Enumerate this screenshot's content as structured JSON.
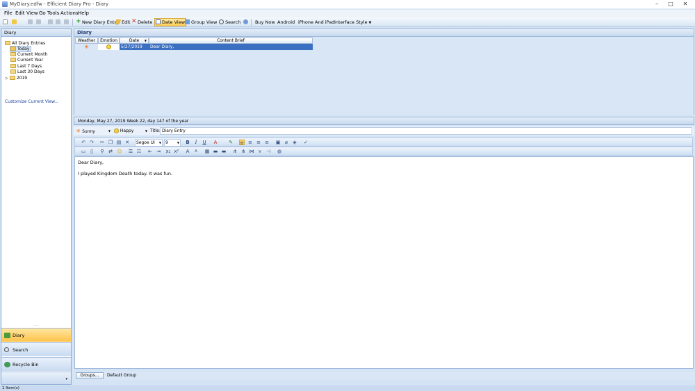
{
  "window": {
    "title": "MyDiary.edfw - Efficient Diary Pro - Diary",
    "minimize": "–",
    "maximize": "□",
    "close": "✕"
  },
  "menu": [
    "File",
    "Edit",
    "View",
    "Go",
    "Tools",
    "Actions",
    "Help"
  ],
  "toolbar": {
    "new_entry": "New Diary Entry",
    "edit": "Edit",
    "delete": "Delete",
    "date_view": "Date View",
    "group_view": "Group View",
    "search": "Search",
    "buy_now": "Buy Now",
    "android": "Android",
    "iphone_ipad": "iPhone And iPad",
    "interface_style": "Interface Style"
  },
  "sidebar": {
    "header": "Diary",
    "tree": {
      "root": "All Diary Entries",
      "items": [
        "Today",
        "Current Month",
        "Current Year",
        "Last 7 Days",
        "Last 30 Days"
      ],
      "year": "2019"
    },
    "customize_link": "Customize Current View...",
    "nav": {
      "diary": "Diary",
      "search": "Search",
      "recycle_bin": "Recycle Bin"
    }
  },
  "main": {
    "header": "Diary",
    "columns": [
      "Weather",
      "Emotion",
      "Date",
      "Content Brief"
    ],
    "rows": [
      {
        "date": "5/27/2019",
        "brief": "Dear Diary,"
      }
    ]
  },
  "entry": {
    "date_line": "Monday, May 27, 2019   Week 22, day 147 of the year",
    "weather": "Sunny",
    "emotion": "Happy",
    "title_label": "Title:",
    "title_value": "Diary Entry",
    "font_name": "Segoe UI",
    "font_size": "9",
    "body_line1": "Dear Diary,",
    "body_line2": "I played Kingdom Death today. It was fun."
  },
  "group": {
    "button": "Groups...",
    "value": "Default Group"
  },
  "status": {
    "text": "1 Item(s)"
  },
  "colors": {
    "selection": "#3a6fc2",
    "active_orange": "#ffc34a",
    "panel_blue": "#d5e4f5"
  }
}
